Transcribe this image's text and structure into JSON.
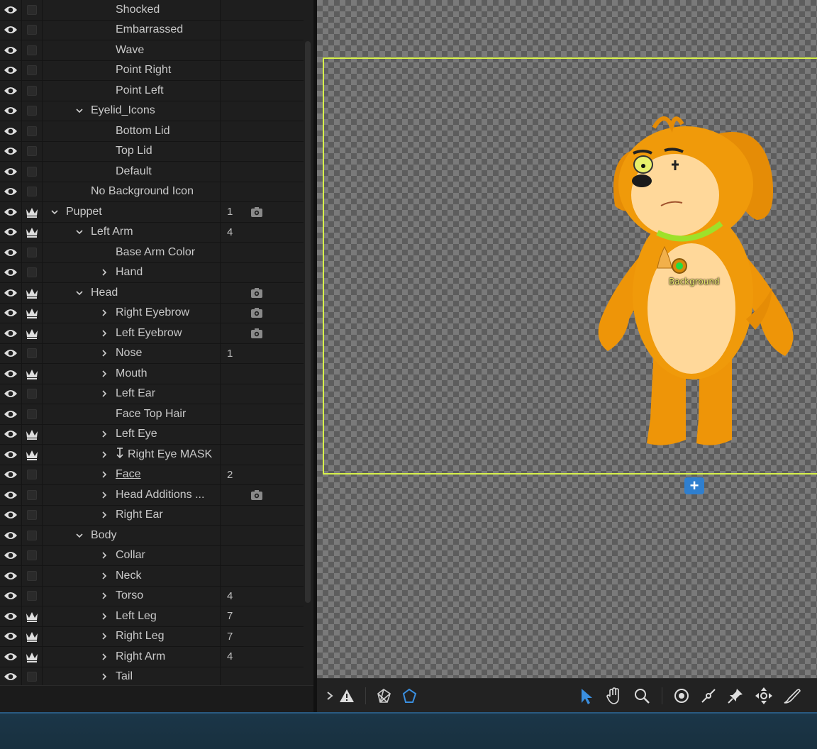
{
  "layers": [
    {
      "name": "Shocked",
      "indent": 3,
      "expander": "none",
      "crown": false,
      "count": "",
      "trigger": false,
      "eye": true
    },
    {
      "name": "Embarrassed",
      "indent": 3,
      "expander": "none",
      "crown": false,
      "count": "",
      "trigger": false,
      "eye": true
    },
    {
      "name": "Wave",
      "indent": 3,
      "expander": "none",
      "crown": false,
      "count": "",
      "trigger": false,
      "eye": true
    },
    {
      "name": "Point Right",
      "indent": 3,
      "expander": "none",
      "crown": false,
      "count": "",
      "trigger": false,
      "eye": true
    },
    {
      "name": "Point Left",
      "indent": 3,
      "expander": "none",
      "crown": false,
      "count": "",
      "trigger": false,
      "eye": true
    },
    {
      "name": "Eyelid_Icons",
      "indent": 2,
      "expander": "open",
      "crown": false,
      "count": "",
      "trigger": false,
      "eye": true
    },
    {
      "name": "Bottom Lid",
      "indent": 3,
      "expander": "none",
      "crown": false,
      "count": "",
      "trigger": false,
      "eye": true
    },
    {
      "name": "Top Lid",
      "indent": 3,
      "expander": "none",
      "crown": false,
      "count": "",
      "trigger": false,
      "eye": true
    },
    {
      "name": "Default",
      "indent": 3,
      "expander": "none",
      "crown": false,
      "count": "",
      "trigger": false,
      "eye": true
    },
    {
      "name": "No Background Icon",
      "indent": 2,
      "expander": "none",
      "crown": false,
      "count": "",
      "trigger": false,
      "eye": true
    },
    {
      "name": "Puppet",
      "indent": 1,
      "expander": "open",
      "crown": true,
      "count": "1",
      "trigger": true,
      "eye": true
    },
    {
      "name": "Left Arm",
      "indent": 2,
      "expander": "open",
      "crown": true,
      "count": "4",
      "trigger": false,
      "eye": true
    },
    {
      "name": "Base Arm Color",
      "indent": 3,
      "expander": "none",
      "crown": false,
      "count": "",
      "trigger": false,
      "eye": true
    },
    {
      "name": "Hand",
      "indent": 3,
      "expander": "closed",
      "crown": false,
      "count": "",
      "trigger": false,
      "eye": true
    },
    {
      "name": "Head",
      "indent": 2,
      "expander": "open",
      "crown": true,
      "count": "",
      "trigger": true,
      "eye": true
    },
    {
      "name": "Right Eyebrow",
      "indent": 3,
      "expander": "closed",
      "crown": true,
      "count": "",
      "trigger": true,
      "eye": true
    },
    {
      "name": "Left Eyebrow",
      "indent": 3,
      "expander": "closed",
      "crown": true,
      "count": "",
      "trigger": true,
      "eye": true
    },
    {
      "name": "Nose",
      "indent": 3,
      "expander": "closed",
      "crown": false,
      "count": "1",
      "trigger": false,
      "eye": true
    },
    {
      "name": "Mouth",
      "indent": 3,
      "expander": "closed",
      "crown": true,
      "count": "",
      "trigger": false,
      "eye": true
    },
    {
      "name": "Left Ear",
      "indent": 3,
      "expander": "closed",
      "crown": false,
      "count": "",
      "trigger": false,
      "eye": true
    },
    {
      "name": "Face Top Hair",
      "indent": 3,
      "expander": "none",
      "crown": false,
      "count": "",
      "trigger": false,
      "eye": true
    },
    {
      "name": "Left Eye",
      "indent": 3,
      "expander": "closed",
      "crown": true,
      "count": "",
      "trigger": false,
      "eye": true
    },
    {
      "name": "Right Eye MASK",
      "indent": 3,
      "expander": "closed",
      "crown": true,
      "count": "",
      "trigger": false,
      "eye": true,
      "mask": true
    },
    {
      "name": "Face",
      "indent": 3,
      "expander": "closed",
      "crown": false,
      "count": "2",
      "trigger": false,
      "eye": true,
      "underline": true
    },
    {
      "name": "Head Additions ...",
      "indent": 3,
      "expander": "closed",
      "crown": false,
      "count": "",
      "trigger": true,
      "eye": true
    },
    {
      "name": "Right Ear",
      "indent": 3,
      "expander": "closed",
      "crown": false,
      "count": "",
      "trigger": false,
      "eye": true
    },
    {
      "name": "Body",
      "indent": 2,
      "expander": "open",
      "crown": false,
      "count": "",
      "trigger": false,
      "eye": true
    },
    {
      "name": "Collar",
      "indent": 3,
      "expander": "closed",
      "crown": false,
      "count": "",
      "trigger": false,
      "eye": true
    },
    {
      "name": "Neck",
      "indent": 3,
      "expander": "closed",
      "crown": false,
      "count": "",
      "trigger": false,
      "eye": true
    },
    {
      "name": "Torso",
      "indent": 3,
      "expander": "closed",
      "crown": false,
      "count": "4",
      "trigger": false,
      "eye": true
    },
    {
      "name": "Left Leg",
      "indent": 3,
      "expander": "closed",
      "crown": true,
      "count": "7",
      "trigger": false,
      "eye": true
    },
    {
      "name": "Right Leg",
      "indent": 3,
      "expander": "closed",
      "crown": true,
      "count": "7",
      "trigger": false,
      "eye": true
    },
    {
      "name": "Right Arm",
      "indent": 3,
      "expander": "closed",
      "crown": true,
      "count": "4",
      "trigger": false,
      "eye": true
    },
    {
      "name": "Tail",
      "indent": 3,
      "expander": "closed",
      "crown": false,
      "count": "",
      "trigger": false,
      "eye": true
    }
  ],
  "scene": {
    "handle_label": "Background",
    "add_button_label": "+",
    "bounds_color": "#d6f04a"
  },
  "toolbar": {
    "left_tools": [
      "expand-icon",
      "warning-icon",
      "mesh-icon",
      "outline-icon"
    ],
    "right_tools": [
      "select-arrow-icon",
      "hand-icon",
      "zoom-icon",
      "origin-handle-icon",
      "stick-icon",
      "pin-icon",
      "dragger-icon",
      "draw-icon"
    ],
    "active_tool": "select-arrow-icon",
    "accent": "#3a8fe0"
  },
  "colors": {
    "puppet_orange": "#f0980a",
    "puppet_belly": "#ffd99a",
    "collar_green": "#9ee12a"
  }
}
